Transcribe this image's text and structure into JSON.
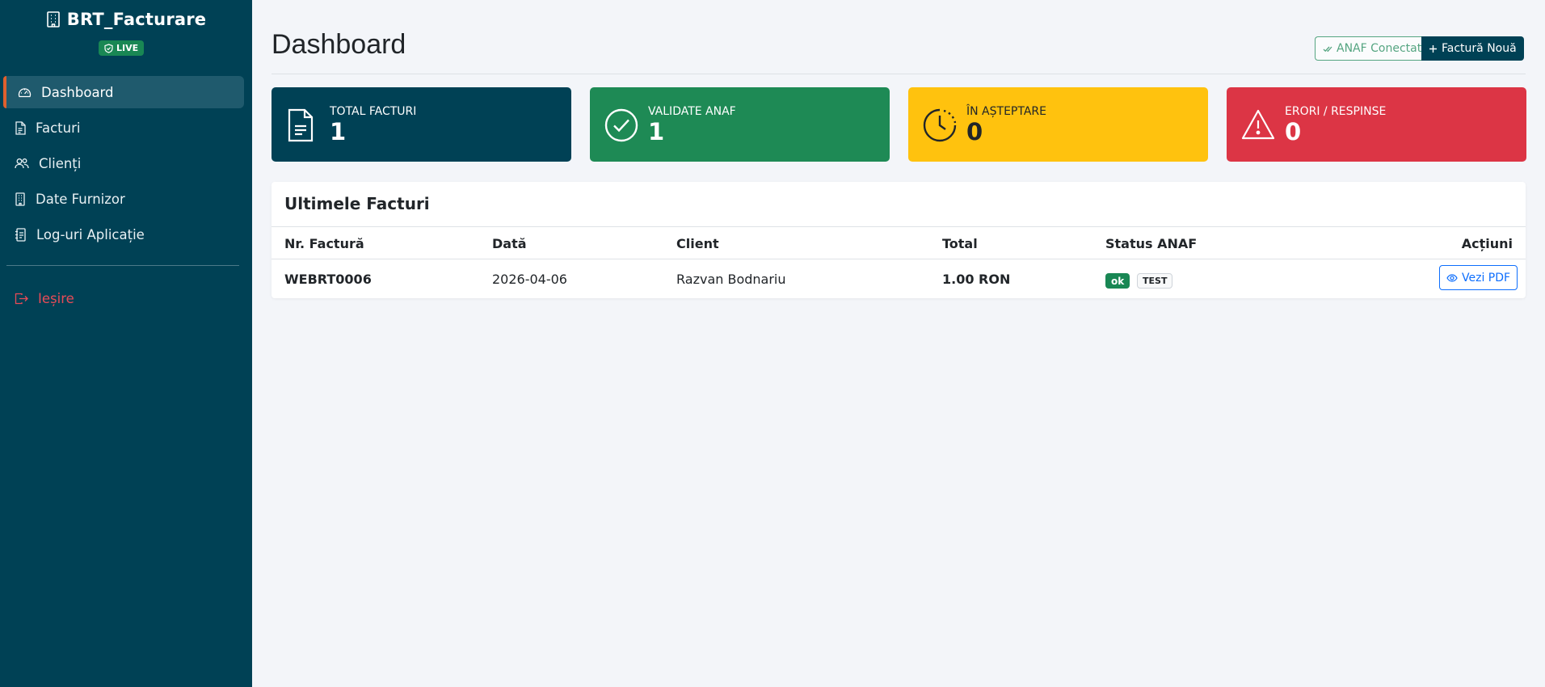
{
  "sidebar": {
    "brand": "BRT_Facturare",
    "env_badge": "LIVE",
    "items": [
      {
        "label": "Dashboard",
        "icon": "speedometer-icon",
        "active": true
      },
      {
        "label": "Facturi",
        "icon": "file-text-icon"
      },
      {
        "label": "Clienți",
        "icon": "people-icon"
      },
      {
        "label": "Date Furnizor",
        "icon": "building-icon"
      },
      {
        "label": "Log-uri Aplicație",
        "icon": "journal-text-icon"
      }
    ],
    "logout": "Ieșire"
  },
  "header": {
    "title": "Dashboard",
    "anaf_status": "ANAF Conectat",
    "new_invoice": "Factură Nouă"
  },
  "stats": [
    {
      "label": "TOTAL FACTURI",
      "value": "1",
      "color": "#004155",
      "icon": "file-icon"
    },
    {
      "label": "VALIDATE ANAF",
      "value": "1",
      "color": "#1e8a55",
      "icon": "check-circle-icon"
    },
    {
      "label": "ÎN AȘTEPTARE",
      "value": "0",
      "color": "#ffc20e",
      "icon": "clock-icon"
    },
    {
      "label": "ERORI / RESPINSE",
      "value": "0",
      "color": "#dc3545",
      "icon": "warning-icon"
    }
  ],
  "recent": {
    "title": "Ultimele Facturi",
    "columns": [
      "Nr. Factură",
      "Dată",
      "Client",
      "Total",
      "Status ANAF",
      "Acțiuni"
    ],
    "rows": [
      {
        "number": "WEBRT0006",
        "date": "2026-04-06",
        "client": "Razvan Bodnariu",
        "total": "1.00 RON",
        "status": "ok",
        "mode": "TEST",
        "action": "Vezi PDF"
      }
    ]
  }
}
